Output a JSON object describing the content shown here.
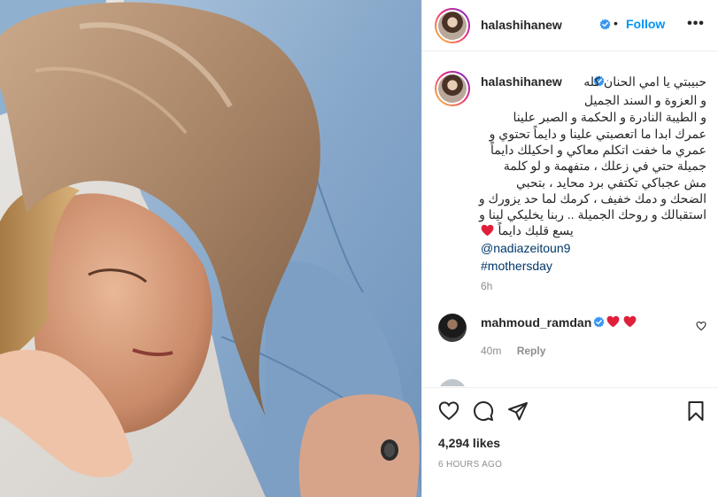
{
  "post": {
    "username": "halashihanew",
    "follow_label": "Follow",
    "dot": "•",
    "more": "•••",
    "caption": {
      "lines": [
        "حبيبتي يا امي الحنان كله",
        "و العزوة و السند الجميل",
        "و الطيبة النادرة و الحكمة و الصبر علينا",
        "عمرك ابدا ما اتعصبتي علينا و دايماً تحتوي و",
        "عمري ما خفت اتكلم معاكي و احكيلك دايماً",
        "جميلة حتي في زعلك ، متفهمة و لو كلمة",
        "مش عجباكي تكتفي برد محايد ، بتحبي",
        "الضحك و دمك خفيف ، كرمك لما حد يزورك و",
        "استقبالك و روحك الجميلة .. ربنا يخليكي لينا و",
        "يسع قلبك دايماً"
      ],
      "mention": "@nadiazeitoun9",
      "hashtag": "#mothersday",
      "time": "6h"
    },
    "comment": {
      "username": "mahmoud_ramdan",
      "time": "40m",
      "reply_label": "Reply"
    },
    "likes": "4,294 likes",
    "posted_ago": "6 HOURS AGO"
  },
  "colors": {
    "accent": "#0095f6",
    "link": "#00376b",
    "verified": "#3897f0",
    "heart": "#ed4956",
    "muted": "#8e8e8e",
    "text": "#262626"
  },
  "icons": {
    "like": "heart-outline-icon",
    "comment": "comment-bubble-icon",
    "share": "paper-plane-icon",
    "save": "bookmark-icon",
    "verified": "verified-badge-icon",
    "more": "more-options-icon"
  }
}
